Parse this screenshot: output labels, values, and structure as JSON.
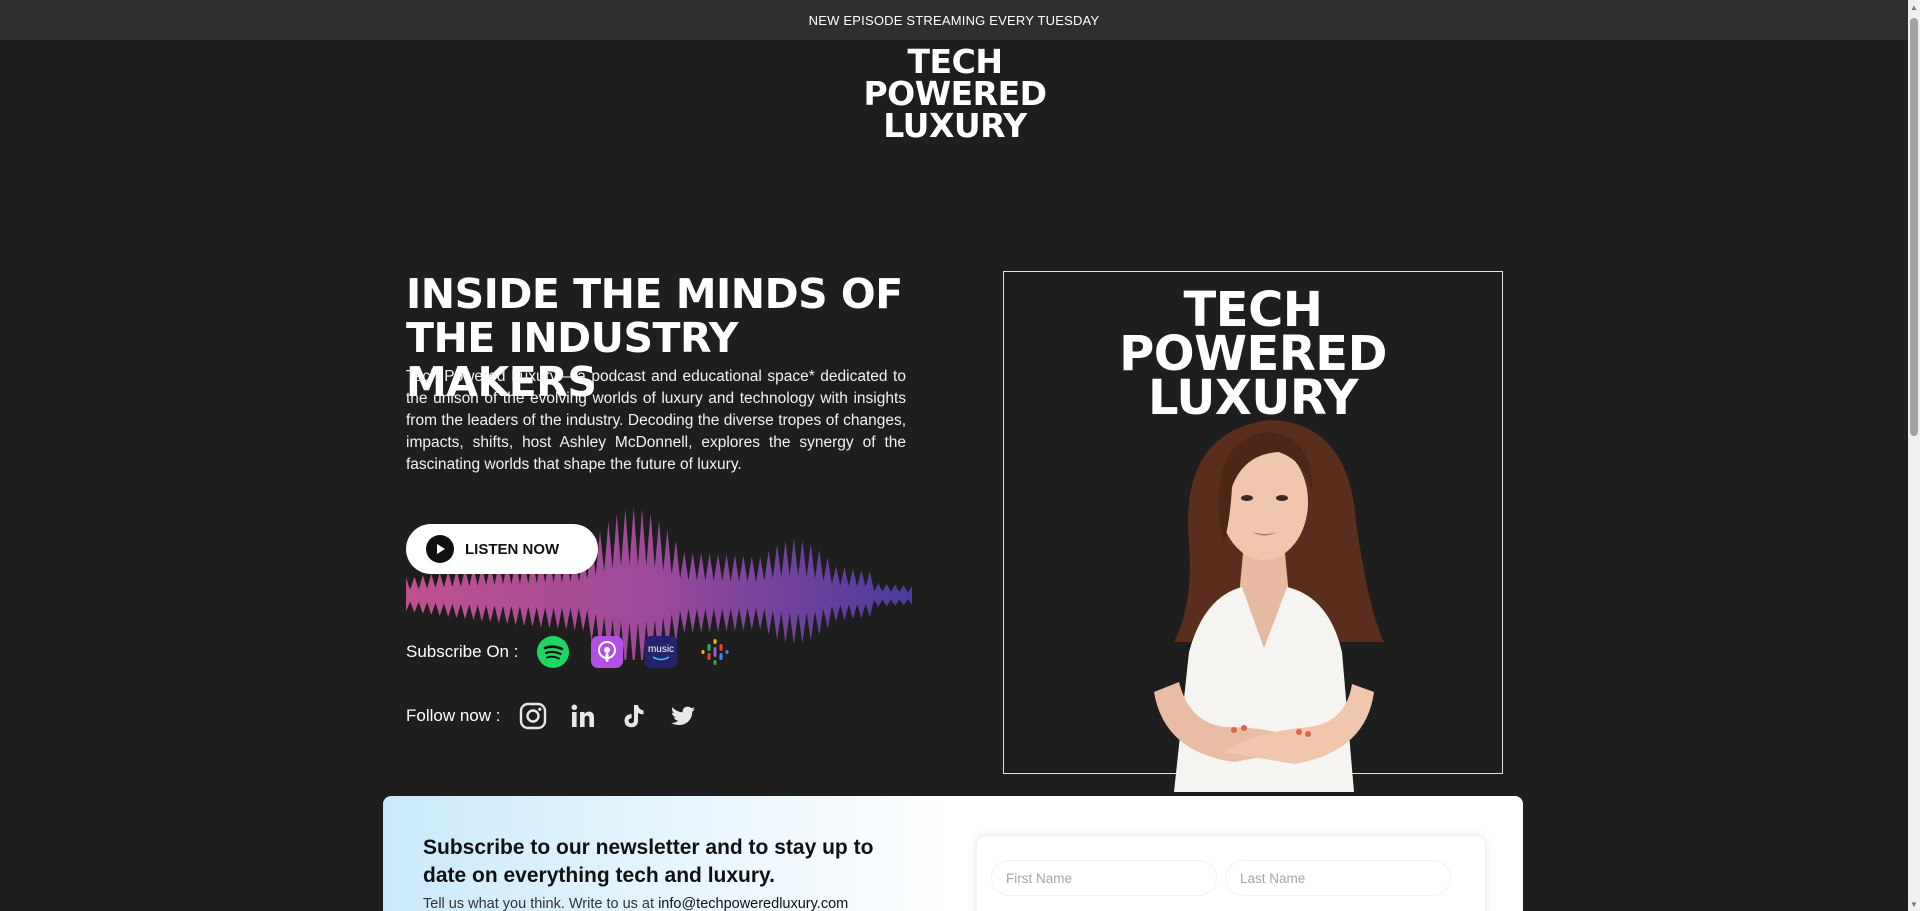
{
  "announcement": "NEW EPISODE STREAMING EVERY TUESDAY",
  "logo": {
    "line1": "TECH",
    "line2": "POWERED",
    "line3": "LUXURY"
  },
  "hero": {
    "title_line1": "INSIDE THE MINDS OF",
    "title_line2": "THE INDUSTRY MAKERS",
    "description": "Tech Powered Luxury – a podcast and educational space* dedicated to the unison of the evolving worlds of luxury and technology with insights from the leaders of the industry. Decoding the diverse tropes of changes, impacts, shifts, host Ashley McDonnell, explores the synergy of the fascinating worlds that shape the future of luxury.",
    "listen_label": "LISTEN NOW"
  },
  "subscribe": {
    "label": "Subscribe On :",
    "platforms": [
      "spotify-icon",
      "apple-podcasts-icon",
      "amazon-music-icon",
      "google-podcasts-icon"
    ]
  },
  "follow": {
    "label": "Follow now :",
    "networks": [
      "instagram-icon",
      "linkedin-icon",
      "tiktok-icon",
      "twitter-icon"
    ]
  },
  "cover": {
    "line1": "TECH",
    "line2": "POWERED",
    "line3": "LUXURY"
  },
  "newsletter": {
    "title": "Subscribe to our newsletter and to stay up to date on everything tech and luxury.",
    "subtitle_prefix": "Tell us what you think. Write to us at ",
    "email": "info@techpoweredluxury.com",
    "first_name_placeholder": "First Name",
    "last_name_placeholder": "Last Name"
  },
  "colors": {
    "background": "#1e1e1e",
    "topbar": "#2f2f2f",
    "wave_pink": "#c0508f",
    "wave_purple": "#5a3fa0",
    "spotify": "#1ed760",
    "apple_podcasts": "#b150e2",
    "amazon_music": "#25246b",
    "newsletter_gradient": "#c9e9fb"
  }
}
